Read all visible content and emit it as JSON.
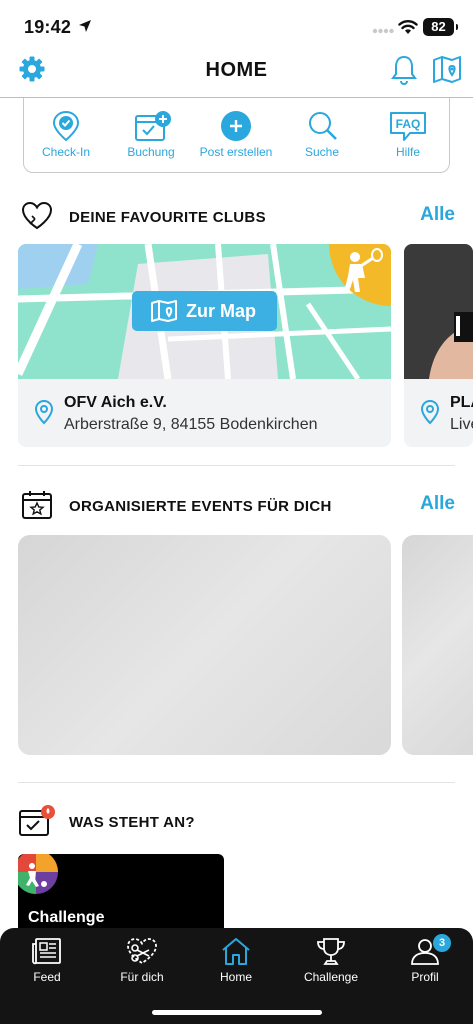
{
  "status": {
    "time": "19:42",
    "battery": "82"
  },
  "header": {
    "title": "HOME"
  },
  "quick_actions": [
    {
      "label": "Check-In",
      "icon": "check-in-pin-icon"
    },
    {
      "label": "Buchung",
      "icon": "booking-calendar-icon"
    },
    {
      "label": "Post erstellen",
      "icon": "plus-circle-icon"
    },
    {
      "label": "Suche",
      "icon": "search-icon"
    },
    {
      "label": "Hilfe",
      "icon": "faq-bubble-icon"
    }
  ],
  "favourites": {
    "title": "DEINE FAVOURITE CLUBS",
    "all_label": "Alle",
    "clubs": [
      {
        "name": "OFV Aich e.V.",
        "address": "Arberstraße 9, 84155 Bodenkirchen",
        "map_button": "Zur Map"
      },
      {
        "name": "PLA",
        "address": "Live"
      }
    ]
  },
  "events": {
    "title": "ORGANISIERTE EVENTS FÜR DICH",
    "all_label": "Alle"
  },
  "upcoming": {
    "title": "WAS STEHT AN?",
    "card_label": "Challenge"
  },
  "tabs": [
    {
      "label": "Feed",
      "icon": "newspaper-icon"
    },
    {
      "label": "Für dich",
      "icon": "heart-scissors-icon"
    },
    {
      "label": "Home",
      "icon": "home-icon"
    },
    {
      "label": "Challenge",
      "icon": "trophy-icon"
    },
    {
      "label": "Profil",
      "icon": "profile-icon",
      "badge": "3"
    }
  ],
  "colors": {
    "accent": "#2aa7dd",
    "map_green": "#8fe3cc",
    "badge_yellow": "#f4b929",
    "tabbar": "#141414"
  }
}
